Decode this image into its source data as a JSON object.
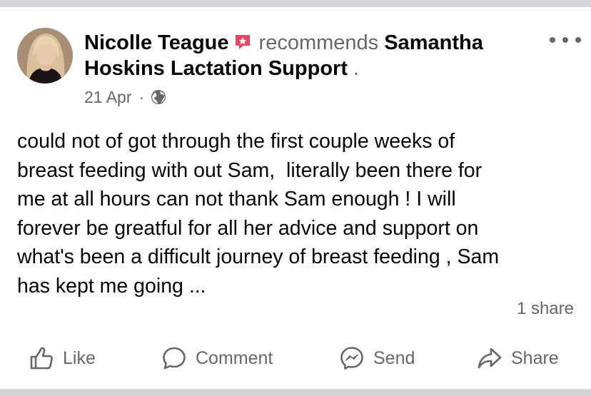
{
  "post": {
    "author": "Nicolle Teague",
    "verb": "recommends",
    "page": "Samantha Hoskins Lactation Support",
    "page_suffix": " .",
    "date": "21 Apr",
    "separator": "·",
    "audience_icon": "globe-icon",
    "recommend_icon": "recommendation-badge-icon",
    "recommend_color": "#f3425f",
    "more_icon": "more-options-icon",
    "body": "could not of got through the first couple weeks of\nbreast feeding with out Sam,  literally been there for\nme at all hours can not thank Sam enough ! I will\nforever be greatful for all her advice and support on\nwhat's been a difficult journey of breast feeding , Sam\nhas kept me going ...",
    "share_count": "1 share"
  },
  "actions": {
    "like": {
      "label": "Like",
      "icon": "thumbs-up-icon"
    },
    "comment": {
      "label": "Comment",
      "icon": "comment-bubble-icon"
    },
    "send": {
      "label": "Send",
      "icon": "messenger-icon"
    },
    "share": {
      "label": "Share",
      "icon": "share-arrow-icon"
    }
  },
  "colors": {
    "text": "#050505",
    "muted": "#65676b",
    "background": "#d3d4d8",
    "card": "#ffffff"
  }
}
